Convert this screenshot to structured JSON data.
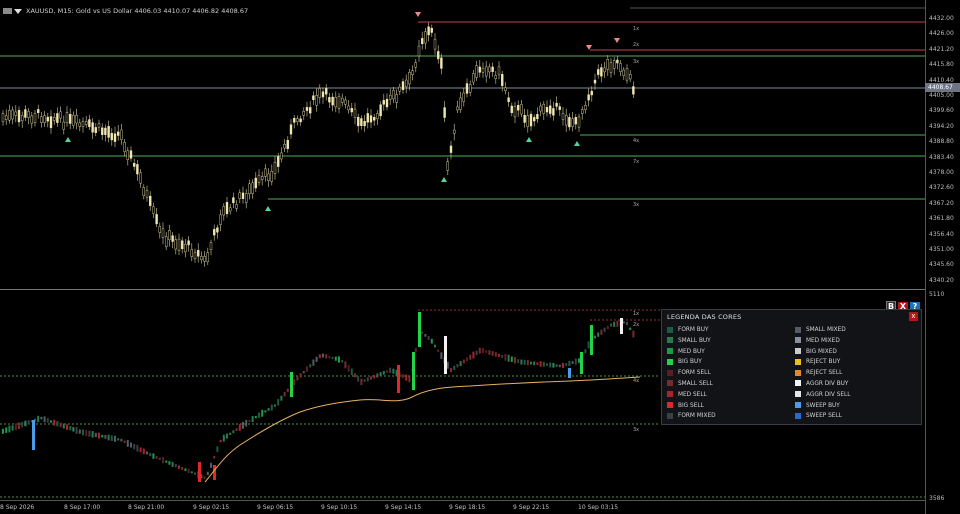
{
  "title": {
    "symbol_line": "XAUUSD, M15:  Gold vs US Dollar   4406.03  4410.07  4406.82  4408.67"
  },
  "price_axis": [
    "4432.00",
    "4426.00",
    "4421.20",
    "4415.80",
    "4410.40",
    "4405.00",
    "4399.60",
    "4394.20",
    "4388.80",
    "4383.40",
    "4378.00",
    "4372.60",
    "4367.20",
    "4361.80",
    "4356.40",
    "4351.00",
    "4345.60",
    "4340.20"
  ],
  "current_price": "4408.67",
  "indicator_axis": {
    "top": "5110",
    "bottom": "3586"
  },
  "buttons": {
    "b": "B",
    "x": "X",
    "help": "?"
  },
  "level_labels": {
    "upper": [
      "1x",
      "2x",
      "3x"
    ],
    "lower": [
      "4x",
      "7x",
      "3x"
    ],
    "ind": [
      "1x",
      "2x",
      "4x",
      "3x"
    ]
  },
  "time_axis": [
    "8 Sep 2026",
    "8 Sep 17:00",
    "8 Sep 21:00",
    "9 Sep 02:15",
    "9 Sep 06:15",
    "9 Sep 10:15",
    "9 Sep 14:15",
    "9 Sep 18:15",
    "9 Sep 22:15",
    "10 Sep 03:15"
  ],
  "legend": {
    "title": "LEGENDA DAS CORES",
    "close": "x",
    "left": [
      {
        "label": "FORM BUY",
        "color": "#1e5a44"
      },
      {
        "label": "SMALL BUY",
        "color": "#2a7a50"
      },
      {
        "label": "MED BUY",
        "color": "#1c9b4a"
      },
      {
        "label": "BIG BUY",
        "color": "#22d44a"
      },
      {
        "label": "FORM SELL",
        "color": "#5a1e22"
      },
      {
        "label": "SMALL SELL",
        "color": "#7a2a2e"
      },
      {
        "label": "MED SELL",
        "color": "#a8242a"
      },
      {
        "label": "BIG SELL",
        "color": "#e0282c"
      },
      {
        "label": "FORM MIXED",
        "color": "#3a3f4a"
      }
    ],
    "right": [
      {
        "label": "SMALL MIXED",
        "color": "#555b66"
      },
      {
        "label": "MED MIXED",
        "color": "#8a909a"
      },
      {
        "label": "BIG MIXED",
        "color": "#c8ccd2"
      },
      {
        "label": "REJECT BUY",
        "color": "#e8c020"
      },
      {
        "label": "REJECT SELL",
        "color": "#e8882a"
      },
      {
        "label": "AGGR DIV BUY",
        "color": "#f2f2f2"
      },
      {
        "label": "AGGR DIV SELL",
        "color": "#e6e6e6"
      },
      {
        "label": "SWEEP BUY",
        "color": "#4a9be8"
      },
      {
        "label": "SWEEP SELL",
        "color": "#2a6ac8"
      }
    ]
  },
  "colors": {
    "candle_up": "#f0e6b0",
    "grid_green": "#4fae5a",
    "resist_red": "#c0464a",
    "vwap": "#e8b060",
    "signal_buy": "#4fd6a0",
    "signal_sell": "#f08a8a"
  }
}
